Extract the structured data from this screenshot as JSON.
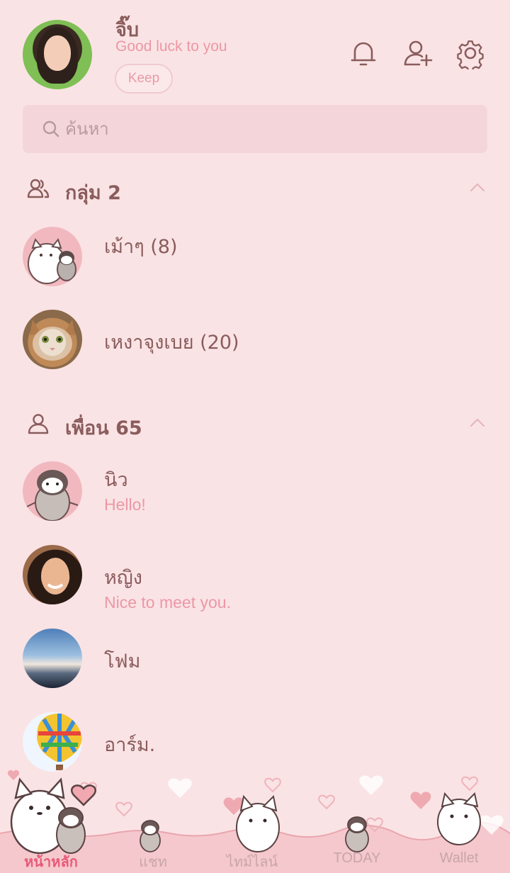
{
  "profile": {
    "name": "จิ๊บ",
    "status": "Good luck to you",
    "keep_label": "Keep"
  },
  "search": {
    "placeholder": "ค้นหา"
  },
  "groups": {
    "title": "กลุ่ม 2",
    "items": [
      {
        "name": "เม้าๆ (8)"
      },
      {
        "name": "เหงาจุงเบย (20)"
      }
    ]
  },
  "friends": {
    "title": "เพื่อน 65",
    "items": [
      {
        "name": "นิว",
        "message": "Hello!"
      },
      {
        "name": "หญิง",
        "message": "Nice to meet you."
      },
      {
        "name": "โฟม"
      },
      {
        "name": "อาร์ม."
      }
    ]
  },
  "tabs": [
    {
      "label": "หน้าหลัก",
      "active": true
    },
    {
      "label": "แชท"
    },
    {
      "label": "ไทม์ไลน์"
    },
    {
      "label": "TODAY"
    },
    {
      "label": "Wallet"
    }
  ],
  "colors": {
    "background": "#fae3e5",
    "accent": "#eb98a4",
    "active_tab": "#e85a78",
    "text": "#8a5c5c"
  }
}
